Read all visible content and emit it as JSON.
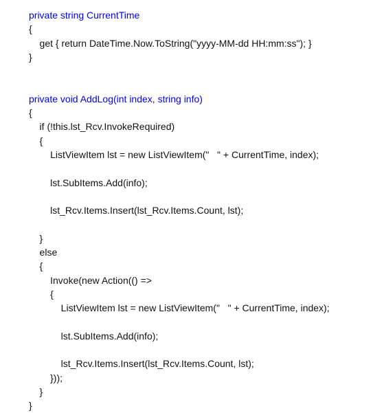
{
  "code": {
    "lines": [
      "private string CurrentTime",
      "{",
      "    get { return DateTime.Now.ToString(\"yyyy-MM-dd HH:mm:ss\"); }",
      "}",
      "",
      "",
      "private void AddLog(int index, string info)",
      "{",
      "    if (!this.lst_Rcv.InvokeRequired)",
      "    {",
      "        ListViewItem lst = new ListViewItem(\"   \" + CurrentTime, index);",
      "",
      "        lst.SubItems.Add(info);",
      "",
      "        lst_Rcv.Items.Insert(lst_Rcv.Items.Count, lst);",
      "",
      "    }",
      "    else",
      "    {",
      "        Invoke(new Action(() =>",
      "        {",
      "            ListViewItem lst = new ListViewItem(\"   \" + CurrentTime, index);",
      "",
      "            lst.SubItems.Add(info);",
      "",
      "            lst_Rcv.Items.Insert(lst_Rcv.Items.Count, lst);",
      "        }));",
      "    }",
      "}"
    ]
  }
}
